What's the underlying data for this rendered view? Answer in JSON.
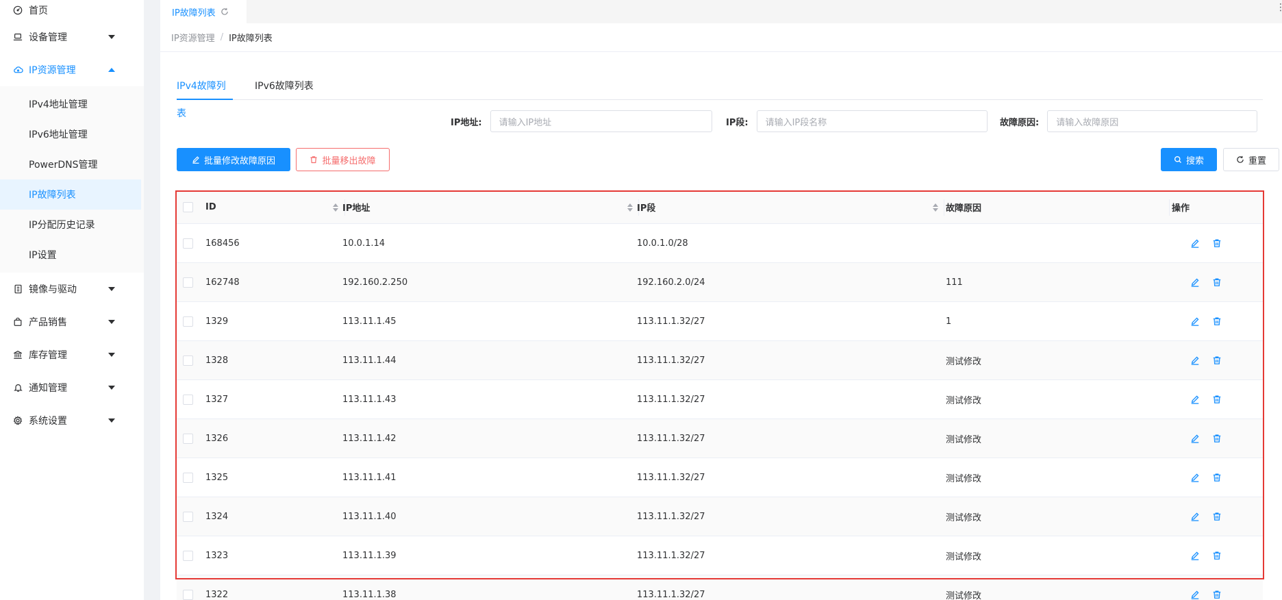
{
  "sidebar": {
    "home": "首页",
    "device_mgmt": "设备管理",
    "ip_resource_mgmt": "IP资源管理",
    "sub_items": [
      "IPv4地址管理",
      "IPv6地址管理",
      "PowerDNS管理",
      "IP故障列表",
      "IP分配历史记录",
      "IP设置"
    ],
    "image_driver": "镜像与驱动",
    "product_sales": "产品销售",
    "inventory_mgmt": "库存管理",
    "notice_mgmt": "通知管理",
    "system_settings": "系统设置"
  },
  "tabbar": {
    "active_tab": "IP故障列表"
  },
  "breadcrumb": {
    "parent": "IP资源管理",
    "separator": "/",
    "current": "IP故障列表"
  },
  "subtabs": {
    "ipv4": "IPv4故障列表",
    "ipv6": "IPv6故障列表"
  },
  "filters": {
    "ip_label": "IP地址:",
    "ip_placeholder": "请输入IP地址",
    "segment_label": "IP段:",
    "segment_placeholder": "请输入IP段名称",
    "reason_label": "故障原因:",
    "reason_placeholder": "请输入故障原因"
  },
  "toolbar": {
    "batch_edit": "批量修改故障原因",
    "batch_remove": "批量移出故障",
    "search": "搜索",
    "reset": "重置"
  },
  "table": {
    "headers": {
      "id": "ID",
      "ip": "IP地址",
      "segment": "IP段",
      "reason": "故障原因",
      "ops": "操作"
    },
    "rows": [
      {
        "id": "168456",
        "ip": "10.0.1.14",
        "segment": "10.0.1.0/28",
        "reason": ""
      },
      {
        "id": "162748",
        "ip": "192.160.2.250",
        "segment": "192.160.2.0/24",
        "reason": "111"
      },
      {
        "id": "1329",
        "ip": "113.11.1.45",
        "segment": "113.11.1.32/27",
        "reason": "1"
      },
      {
        "id": "1328",
        "ip": "113.11.1.44",
        "segment": "113.11.1.32/27",
        "reason": "测试修改"
      },
      {
        "id": "1327",
        "ip": "113.11.1.43",
        "segment": "113.11.1.32/27",
        "reason": "测试修改"
      },
      {
        "id": "1326",
        "ip": "113.11.1.42",
        "segment": "113.11.1.32/27",
        "reason": "测试修改"
      },
      {
        "id": "1325",
        "ip": "113.11.1.41",
        "segment": "113.11.1.32/27",
        "reason": "测试修改"
      },
      {
        "id": "1324",
        "ip": "113.11.1.40",
        "segment": "113.11.1.32/27",
        "reason": "测试修改"
      },
      {
        "id": "1323",
        "ip": "113.11.1.39",
        "segment": "113.11.1.32/27",
        "reason": "测试修改"
      },
      {
        "id": "1322",
        "ip": "113.11.1.38",
        "segment": "113.11.1.32/27",
        "reason": "测试修改"
      }
    ]
  },
  "colors": {
    "accent": "#1890ff",
    "danger": "#f56c6c",
    "highlight": "#e53935"
  }
}
